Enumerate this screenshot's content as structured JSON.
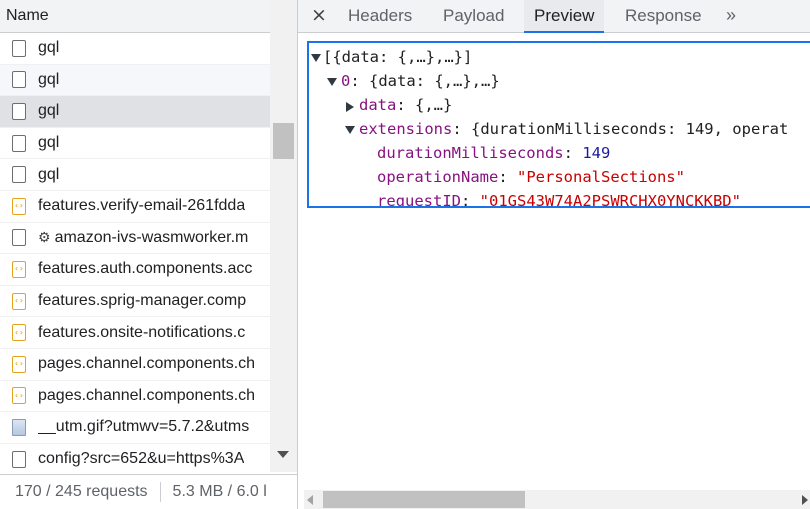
{
  "request_list": {
    "header": "Name",
    "rows": [
      {
        "name": "gql",
        "icon": "document-icon"
      },
      {
        "name": "gql",
        "icon": "document-icon"
      },
      {
        "name": "gql",
        "icon": "document-icon"
      },
      {
        "name": "gql",
        "icon": "document-icon"
      },
      {
        "name": "gql",
        "icon": "document-icon"
      },
      {
        "name": "features.verify-email-261fdda",
        "icon": "script-icon"
      },
      {
        "name": "amazon-ivs-wasmworker.m",
        "icon": "document-icon",
        "prefix_icon": "gear-icon"
      },
      {
        "name": "features.auth.components.acc",
        "icon": "script-icon"
      },
      {
        "name": "features.sprig-manager.comp",
        "icon": "script-icon"
      },
      {
        "name": "features.onsite-notifications.c",
        "icon": "script-icon"
      },
      {
        "name": "pages.channel.components.ch",
        "icon": "script-icon"
      },
      {
        "name": "pages.channel.components.ch",
        "icon": "script-icon"
      },
      {
        "name": "__utm.gif?utmwv=5.7.2&utms",
        "icon": "image-icon"
      },
      {
        "name": "config?src=652&u=https%3A",
        "icon": "document-icon"
      }
    ],
    "selected_index": 2,
    "status": {
      "requests": "170 / 245 requests",
      "transferred": "5.3 MB / 6.0 l"
    }
  },
  "detail": {
    "close_glyph": "×",
    "tabs": [
      {
        "label": "Headers",
        "active": false
      },
      {
        "label": "Payload",
        "active": false
      },
      {
        "label": "Preview",
        "active": true
      },
      {
        "label": "Response",
        "active": false
      }
    ],
    "more_glyph": "»",
    "preview": {
      "root": "[{data: {,…},…}]",
      "item_index": "0",
      "item_summary": "{data: {,…},…}",
      "data_key": "data",
      "data_summary": "{,…}",
      "extensions_key": "extensions",
      "extensions_summary": "{durationMilliseconds: 149, operat",
      "duration_key": "durationMilliseconds",
      "duration_value": "149",
      "operation_key": "operationName",
      "operation_value": "\"PersonalSections\"",
      "request_key": "requestID",
      "request_value": "\"01GS43W74A2PSWRCHX0YNCKKBD\""
    }
  },
  "colors": {
    "accent": "#1a73e8",
    "json_key": "#881280",
    "json_number": "#1a1aa6",
    "json_string": "#c80000",
    "script_icon": "#e8a31c"
  }
}
